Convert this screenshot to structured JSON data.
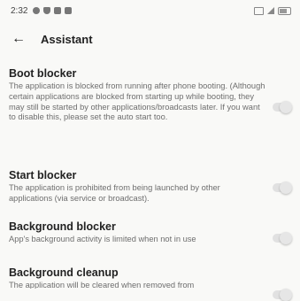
{
  "status_bar": {
    "time": "2:32"
  },
  "app_bar": {
    "title": "Assistant",
    "back_glyph": "←"
  },
  "settings": [
    {
      "title": "Boot blocker",
      "description": "The application is blocked from running after phone booting. (Although certain applications are blocked from starting up while booting, they may still be started by other applications/broadcasts later. If you want to disable this, please set the auto start too.",
      "enabled": false
    },
    {
      "title": "Start blocker",
      "description": "The application is prohibited from being launched by other applications (via service or broadcast).",
      "enabled": false
    },
    {
      "title": "Background blocker",
      "description": "App's background activity is limited when not in use",
      "enabled": false
    },
    {
      "title": "Background cleanup",
      "description": "The application will be cleared when removed from",
      "enabled": false
    }
  ],
  "colors": {
    "background": "#f9f9f7",
    "toggle_track": "#e1e1e1",
    "toggle_thumb": "#e6e6e6"
  }
}
